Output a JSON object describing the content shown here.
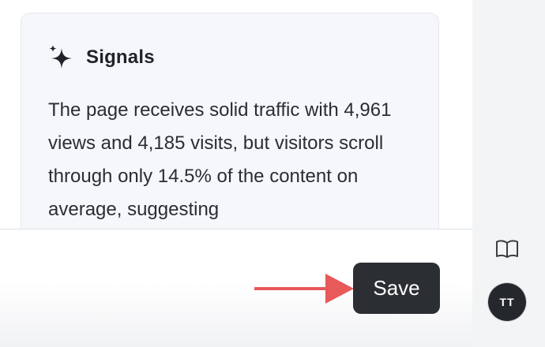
{
  "signals_card": {
    "title": "Signals",
    "title_icon": "sparkle-icon",
    "body": "The page receives solid traffic with 4,961 views and 4,185 visits, but visitors scroll through only 14.5% of the content on average, suggesting"
  },
  "footer": {
    "save_label": "Save"
  },
  "sidebar": {
    "docs_icon": "book-open-icon",
    "avatar_initials": "TT"
  },
  "colors": {
    "card_background": "#f6f7fb",
    "save_button_background": "#2b2f33",
    "annotation_arrow": "#e8595a",
    "avatar_background": "#24272b",
    "rail_background": "#f3f4f6"
  }
}
